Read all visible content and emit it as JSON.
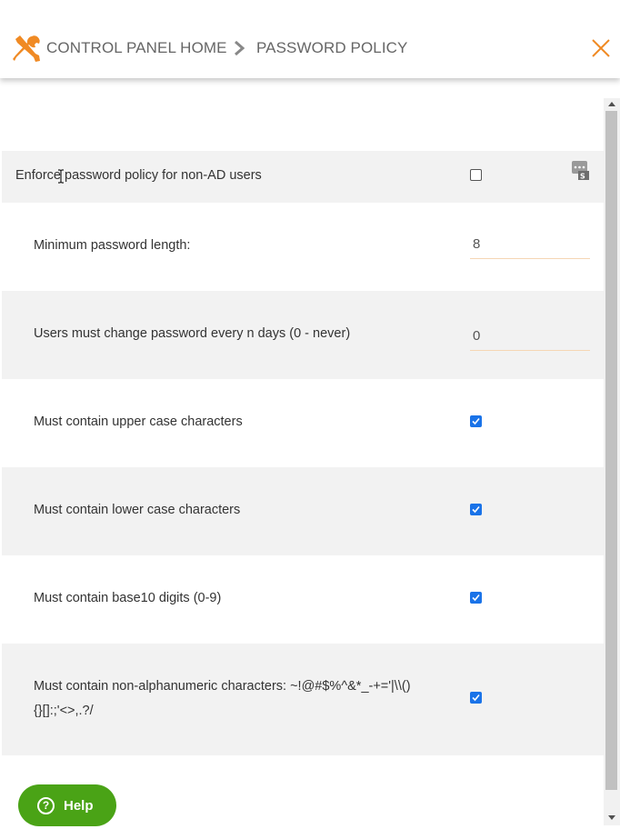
{
  "header": {
    "home_label": "CONTROL PANEL HOME",
    "page_label": "PASSWORD POLICY",
    "accent_color": "#f08a24"
  },
  "policy": {
    "enforce": {
      "label": "Enforce password policy for non-AD users",
      "checked": false
    },
    "min_length": {
      "label": "Minimum password length:",
      "value": "8"
    },
    "change_days": {
      "label": "Users must change password every n days (0 - never)",
      "value": "0"
    },
    "upper": {
      "label": "Must contain upper case characters",
      "checked": true
    },
    "lower": {
      "label": "Must contain lower case characters",
      "checked": true
    },
    "digits": {
      "label": "Must contain base10 digits (0-9)",
      "checked": true
    },
    "special": {
      "label_line1": "Must contain non-alphanumeric characters: ~!@#$%^&*_-+='|\\\\()",
      "label_line2": "{}[]:;'<>,.?/",
      "checked": true
    }
  },
  "help": {
    "label": "Help"
  },
  "icons": [
    "tools-icon",
    "chevron-right-icon",
    "close-icon",
    "password-manager-icon",
    "help-circle-icon"
  ]
}
